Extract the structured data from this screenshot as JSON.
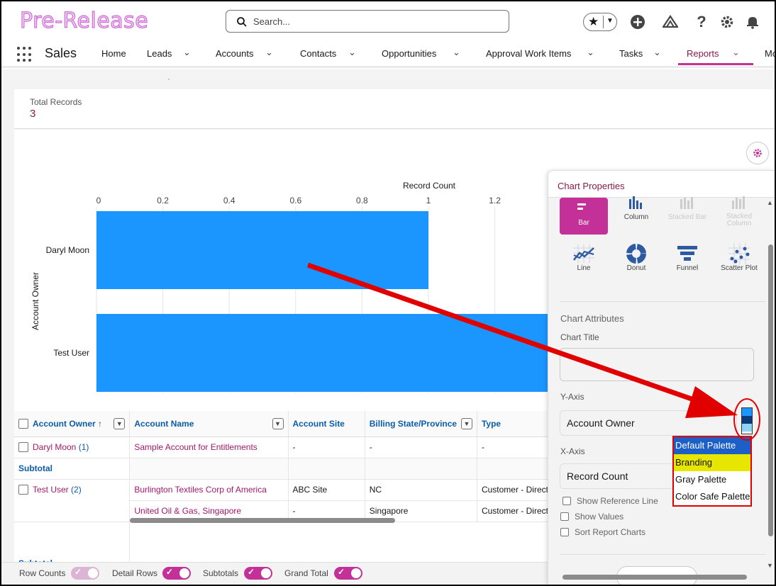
{
  "header": {
    "brand": "Pre-Release",
    "search_placeholder": "Search...",
    "app_name": "Sales"
  },
  "nav": {
    "items": [
      "Home",
      "Leads",
      "Accounts",
      "Contacts",
      "Opportunities",
      "Approval Work Items",
      "Tasks",
      "Reports",
      "Mo"
    ],
    "active": "Reports"
  },
  "summary": {
    "label": "Total Records",
    "value": "3"
  },
  "chart_data": {
    "type": "bar",
    "orientation": "horizontal",
    "title": "Record Count",
    "ylabel": "Account Owner",
    "categories": [
      "Daryl Moon",
      "Test User"
    ],
    "values": [
      1,
      2
    ],
    "xlim": [
      0,
      2
    ],
    "xticks": [
      "0",
      "0.2",
      "0.4",
      "0.6",
      "0.8",
      "1",
      "1.2"
    ],
    "bar_color": "#1b96ff"
  },
  "table": {
    "columns": [
      "Account Owner",
      "Account Name",
      "Account Site",
      "Billing State/Province",
      "Type"
    ],
    "sort_indicator": "↑",
    "groups": [
      {
        "owner": "Daryl Moon",
        "count": "(1)",
        "rows": [
          [
            "Sample Account for Entitlements",
            "-",
            "-",
            "-"
          ]
        ]
      },
      {
        "owner": "Test User",
        "count": "(2)",
        "rows": [
          [
            "Burlington Textiles Corp of America",
            "ABC Site",
            "NC",
            "Customer - Direct"
          ],
          [
            "United Oil & Gas, Singapore",
            "-",
            "Singapore",
            "Customer - Direct"
          ]
        ]
      }
    ],
    "subtotal_label": "Subtotal"
  },
  "footer": {
    "toggles": [
      {
        "label": "Row Counts",
        "on": true,
        "disabled": true
      },
      {
        "label": "Detail Rows",
        "on": true,
        "disabled": false
      },
      {
        "label": "Subtotals",
        "on": true,
        "disabled": false
      },
      {
        "label": "Grand Total",
        "on": true,
        "disabled": false
      }
    ]
  },
  "panel": {
    "title": "Chart Properties",
    "chart_types": [
      {
        "label": "Bar",
        "icon": "bar-chart-icon",
        "selected": true,
        "enabled": true
      },
      {
        "label": "Column",
        "icon": "column-chart-icon",
        "selected": false,
        "enabled": true
      },
      {
        "label": "Stacked Bar",
        "icon": "stacked-bar-icon",
        "selected": false,
        "enabled": false
      },
      {
        "label": "Stacked Column",
        "icon": "stacked-column-icon",
        "selected": false,
        "enabled": false
      },
      {
        "label": "Line",
        "icon": "line-chart-icon",
        "selected": false,
        "enabled": true
      },
      {
        "label": "Donut",
        "icon": "donut-chart-icon",
        "selected": false,
        "enabled": true
      },
      {
        "label": "Funnel",
        "icon": "funnel-chart-icon",
        "selected": false,
        "enabled": true
      },
      {
        "label": "Scatter Plot",
        "icon": "scatter-plot-icon",
        "selected": false,
        "enabled": true
      }
    ],
    "attributes_label": "Chart Attributes",
    "chart_title_label": "Chart Title",
    "chart_title_value": "",
    "y_axis_label": "Y-Axis",
    "y_axis_value": "Account Owner",
    "x_axis_label": "X-Axis",
    "x_axis_value": "Record Count",
    "checkboxes": [
      "Show Reference Line",
      "Show Values",
      "Sort Report Charts"
    ]
  },
  "palette": {
    "options": [
      "Default Palette",
      "Branding",
      "Gray Palette",
      "Color Safe Palette"
    ],
    "highlighted": "Default Palette",
    "swatch_colors": [
      "#1b96ff",
      "#0b3b7a",
      "#8fd3f5"
    ]
  }
}
